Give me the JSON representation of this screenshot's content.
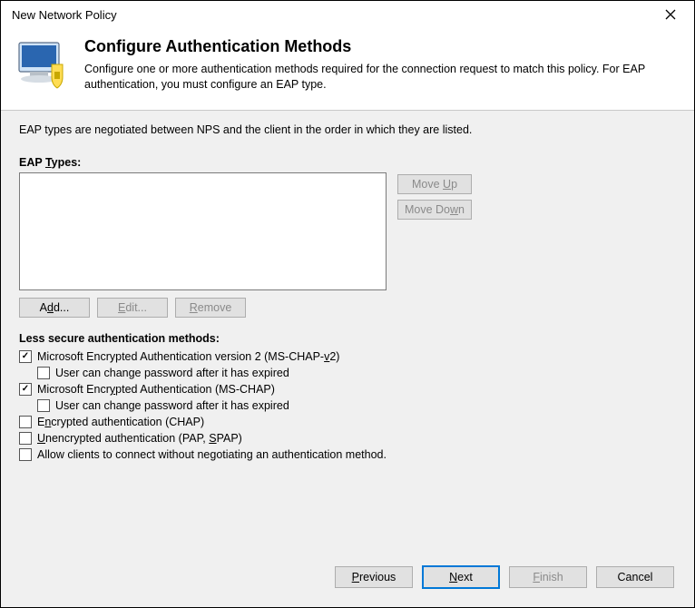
{
  "window_title": "New Network Policy",
  "header": {
    "title": "Configure Authentication Methods",
    "description": "Configure one or more authentication methods required for the connection request to match this policy. For EAP authentication, you must configure an EAP type."
  },
  "info_line": "EAP types are negotiated between NPS and the client in the order in which they are listed.",
  "eap_types_label": "EAP Types:",
  "buttons": {
    "move_up": "Move Up",
    "move_down": "Move Down",
    "add": "Add...",
    "edit": "Edit...",
    "remove": "Remove",
    "previous": "Previous",
    "next": "Next",
    "finish": "Finish",
    "cancel": "Cancel"
  },
  "less_secure_header": "Less secure authentication methods:",
  "auth_methods": {
    "mschap_v2": {
      "label": "Microsoft Encrypted Authentication version 2 (MS-CHAP-v2)",
      "checked": true
    },
    "mschap_v2_pw": {
      "label": "User can change password after it has expired",
      "checked": false
    },
    "mschap": {
      "label": "Microsoft Encrypted Authentication (MS-CHAP)",
      "checked": true
    },
    "mschap_pw": {
      "label": "User can change password after it has expired",
      "checked": false
    },
    "chap": {
      "label": "Encrypted authentication (CHAP)",
      "checked": false
    },
    "pap": {
      "label": "Unencrypted authentication (PAP, SPAP)",
      "checked": false
    },
    "no_auth": {
      "label": "Allow clients to connect without negotiating an authentication method.",
      "checked": false
    }
  }
}
